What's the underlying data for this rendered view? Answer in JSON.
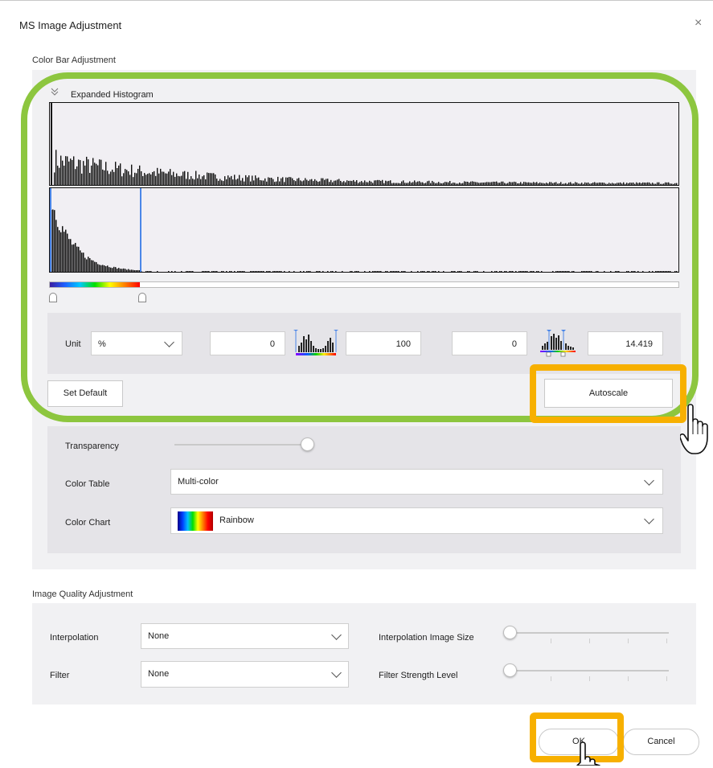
{
  "dialog": {
    "title": "MS Image Adjustment",
    "close_glyph": "×"
  },
  "color_bar": {
    "section_label": "Color Bar Adjustment",
    "histogram_label": "Expanded Histogram",
    "unit_label": "Unit",
    "unit_value": "%",
    "min_value": "0",
    "max_value": "100",
    "range_min": "0",
    "range_max": "14.419",
    "set_default_label": "Set Default",
    "autoscale_label": "Autoscale",
    "transparency_label": "Transparency",
    "transparency_level": 1.0,
    "color_table_label": "Color Table",
    "color_table_value": "Multi-color",
    "color_chart_label": "Color Chart",
    "color_chart_value": "Rainbow"
  },
  "image_quality": {
    "section_label": "Image Quality Adjustment",
    "interpolation_label": "Interpolation",
    "interpolation_value": "None",
    "filter_label": "Filter",
    "filter_value": "None",
    "interp_size_label": "Interpolation Image Size",
    "interp_size_level": 0,
    "filter_strength_label": "Filter Strength Level",
    "filter_strength_level": 0
  },
  "footer": {
    "ok_label": "OK",
    "cancel_label": "Cancel"
  },
  "colors": {
    "highlight_green": "#8dc63f",
    "highlight_orange": "#f7b000",
    "marker_blue": "#4a86e8"
  },
  "icons": [
    "chevron-double-down-icon",
    "histogram-icon",
    "histogram-range-icon",
    "hand-cursor-icon",
    "close-icon"
  ]
}
